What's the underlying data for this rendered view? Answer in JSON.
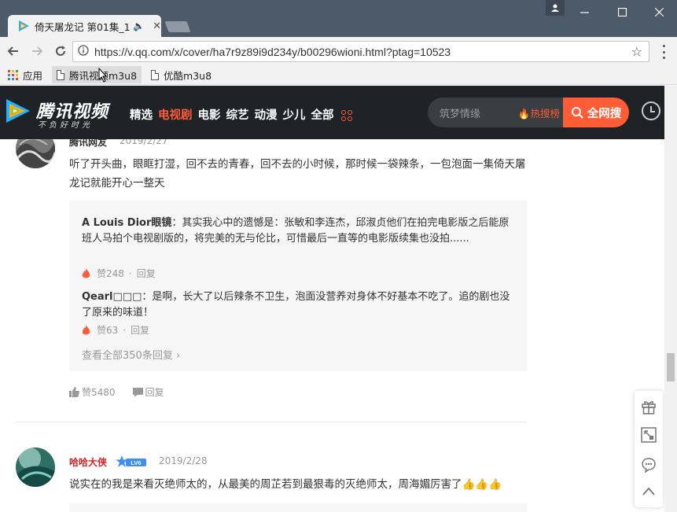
{
  "browser": {
    "tab_title": "倚天屠龙记 第01集_1",
    "url": "https://v.qq.com/x/cover/ha7r9z89i9d234y/b00296wioni.html?ptag=10523",
    "bookmarks": [
      {
        "label": "应用"
      },
      {
        "label": "腾讯视频m3u8"
      },
      {
        "label": "优酷m3u8"
      }
    ],
    "apps_colors": [
      "#ea4335",
      "#fbbc05",
      "#34a853",
      "#4285f4",
      "#ea4335",
      "#fbbc05",
      "#34a853",
      "#4285f4",
      "#ea4335"
    ]
  },
  "site": {
    "logo_text": "腾讯视频",
    "logo_sub": "不负好时光",
    "nav": [
      "精选",
      "电视剧",
      "电影",
      "综艺",
      "动漫",
      "少儿",
      "全部"
    ],
    "nav_active_index": 1,
    "search_placeholder": "筑梦情缘",
    "hot_label": "热搜榜",
    "search_button": "全网搜",
    "accent": "#ff5c38"
  },
  "comments": [
    {
      "user": "腾讯网友",
      "date": "2019/2/27",
      "text": "听了开头曲，眼眶打湿，回不去的青春，回不去的小时候，那时候一袋辣条，一包泡面一集倚天屠龙记就能开心一整天",
      "replies": [
        {
          "user": "A Louis Dior眼镜",
          "text": "：其实我心中的遗憾是：张敏和李连杰，邱淑贞他们在拍完电影版之后能原班人马拍个电视剧版的，将完美的无与伦比，可惜最后一直等的电影版续集也没拍......",
          "likes": "赞248",
          "reply_label": "回复"
        },
        {
          "user": "Qearl□□□",
          "text": "：是啊，长大了以后辣条不卫生，泡面没营养对身体不好基本不吃了。追的剧也没了原来的味道！",
          "likes": "赞63",
          "reply_label": "回复"
        }
      ],
      "view_all": "查看全部350条回复",
      "likes": "赞5480",
      "reply_label": "回复"
    },
    {
      "user": "哈哈大侠",
      "badge": "LV6",
      "date": "2019/2/28",
      "text": "说实在的我是来看灭绝师太的，从最美的周芷若到最狠毒的灭绝师太，周海媚厉害了👍👍👍"
    }
  ]
}
